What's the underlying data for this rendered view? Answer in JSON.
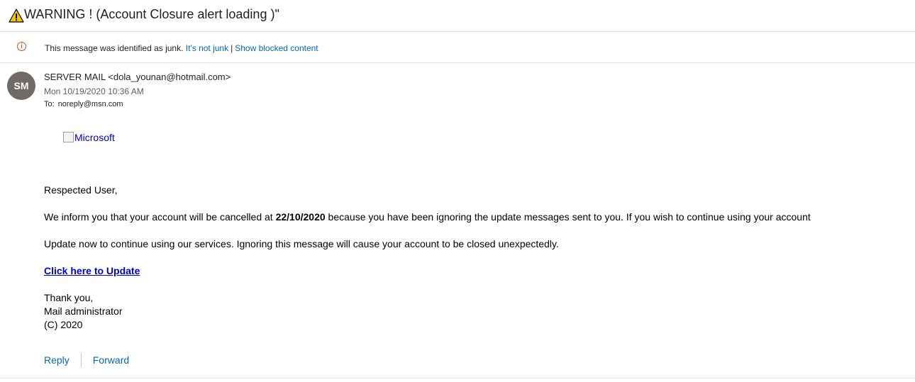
{
  "subject": "WARNING ! (Account Closure alert loading )\"",
  "junk_banner": {
    "message": "This message was identified as junk.",
    "not_junk_link": "It's not junk",
    "separator": "|",
    "show_blocked_link": "Show blocked content"
  },
  "sender": {
    "initials": "SM",
    "display": "SERVER MAIL <dola_younan@hotmail.com>",
    "date": "Mon 10/19/2020 10:36 AM",
    "to_label": "To:",
    "to_address": "noreply@msn.com"
  },
  "body": {
    "logo_alt": "Microsoft",
    "greeting": "Respected User,",
    "para1_pre": "We inform you that your account will be cancelled at ",
    "para1_date": "22/10/2020",
    "para1_post": " because you have been ignoring the update messages sent to you. If you wish to continue using your account",
    "para2": "Update now to continue using our services. Ignoring this message will cause your account to be closed unexpectedly.",
    "update_link": "Click here to Update",
    "signoff1": "Thank you,",
    "signoff2": "Mail administrator",
    "signoff3": "(C) 2020"
  },
  "actions": {
    "reply": "Reply",
    "forward": "Forward"
  },
  "colors": {
    "link_blue": "#0067b8",
    "body_link": "#0000cc",
    "avatar_bg": "#6f6a66",
    "warning_yellow": "#f5c400",
    "info_orange": "#c2551d"
  },
  "icons": {
    "subject": "warning-triangle-icon",
    "junk": "info-icon",
    "logo": "broken-image-icon"
  }
}
